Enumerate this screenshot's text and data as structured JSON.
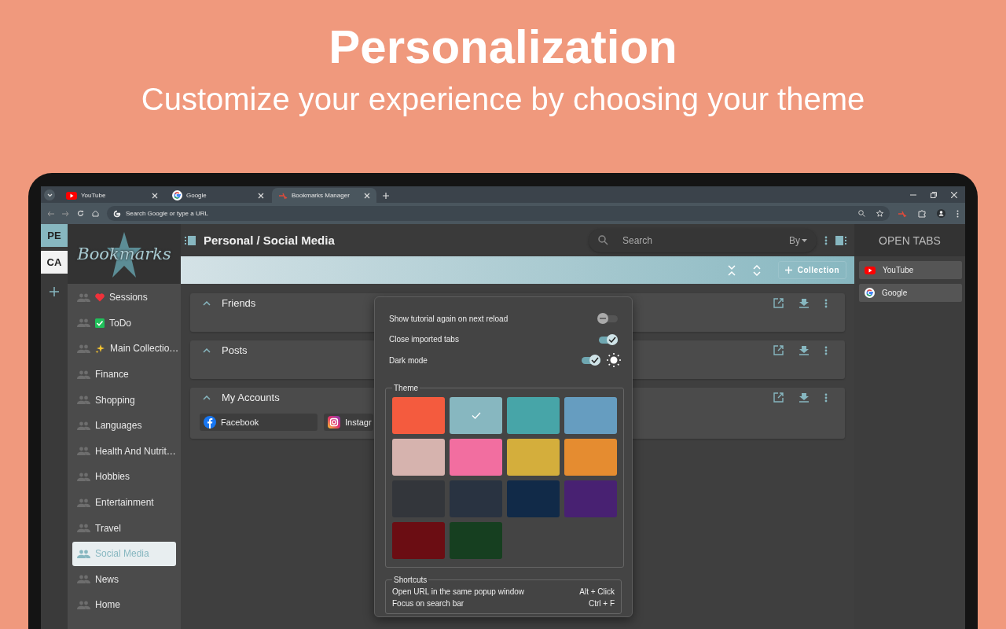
{
  "promo": {
    "title": "Personalization",
    "subtitle": "Customize your experience by choosing your theme"
  },
  "browser": {
    "tabs": [
      {
        "title": "YouTube",
        "selected": false
      },
      {
        "title": "Google",
        "selected": false
      },
      {
        "title": "Bookmarks Manager",
        "selected": true
      }
    ],
    "address_placeholder": "Search Google or type a URL"
  },
  "workspaces": [
    {
      "label": "PE",
      "selected": true
    },
    {
      "label": "CA",
      "selected": false
    }
  ],
  "sidebar": {
    "logo": "Bookmarks",
    "items": [
      {
        "label": "Sessions",
        "selected": false
      },
      {
        "label": "ToDo",
        "selected": false
      },
      {
        "label": "Main Collectio…",
        "selected": false
      },
      {
        "label": "Finance",
        "selected": false
      },
      {
        "label": "Shopping",
        "selected": false
      },
      {
        "label": "Languages",
        "selected": false
      },
      {
        "label": "Health And Nutrit…",
        "selected": false
      },
      {
        "label": "Hobbies",
        "selected": false
      },
      {
        "label": "Entertainment",
        "selected": false
      },
      {
        "label": "Travel",
        "selected": false
      },
      {
        "label": "Social Media",
        "selected": true
      },
      {
        "label": "News",
        "selected": false
      },
      {
        "label": "Home",
        "selected": false
      }
    ]
  },
  "header": {
    "breadcrumb": "Personal / Social Media",
    "search_placeholder": "Search",
    "sort_label": "By"
  },
  "banner": {
    "add_button": "Collection"
  },
  "collections": [
    {
      "title": "Friends",
      "expanded": true
    },
    {
      "title": "Posts",
      "expanded": true
    },
    {
      "title": "My Accounts",
      "expanded": true,
      "links": [
        {
          "title": "Facebook"
        },
        {
          "title": "Instagr"
        }
      ]
    }
  ],
  "settings": {
    "toggles": [
      {
        "label": "Show tutorial again on next reload",
        "on": false,
        "kind": "toggle"
      },
      {
        "label": "Close imported tabs",
        "on": true,
        "kind": "toggle"
      },
      {
        "label": "Dark mode",
        "on": true,
        "kind": "theme-toggle"
      }
    ],
    "theme_legend": "Theme",
    "themes": [
      {
        "color": "#f45b3e",
        "selected": false
      },
      {
        "color": "#87b7c0",
        "selected": true
      },
      {
        "color": "#47a5a8",
        "selected": false
      },
      {
        "color": "#669dc0",
        "selected": false
      },
      {
        "color": "#d6b3ae",
        "selected": false
      },
      {
        "color": "#f26ea0",
        "selected": false
      },
      {
        "color": "#d4ae3c",
        "selected": false
      },
      {
        "color": "#e58c30",
        "selected": false
      },
      {
        "color": "#33363b",
        "selected": false
      },
      {
        "color": "#293341",
        "selected": false
      },
      {
        "color": "#112a48",
        "selected": false
      },
      {
        "color": "#482172",
        "selected": false
      },
      {
        "color": "#6b0d13",
        "selected": false
      },
      {
        "color": "#163f20",
        "selected": false
      }
    ],
    "shortcuts_legend": "Shortcuts",
    "shortcuts": [
      {
        "action": "Open URL in the same popup window",
        "keys": "Alt + Click"
      },
      {
        "action": "Focus on search bar",
        "keys": "Ctrl + F"
      }
    ]
  },
  "open_tabs": {
    "title": "OPEN TABS",
    "items": [
      {
        "title": "YouTube"
      },
      {
        "title": "Google"
      }
    ]
  }
}
